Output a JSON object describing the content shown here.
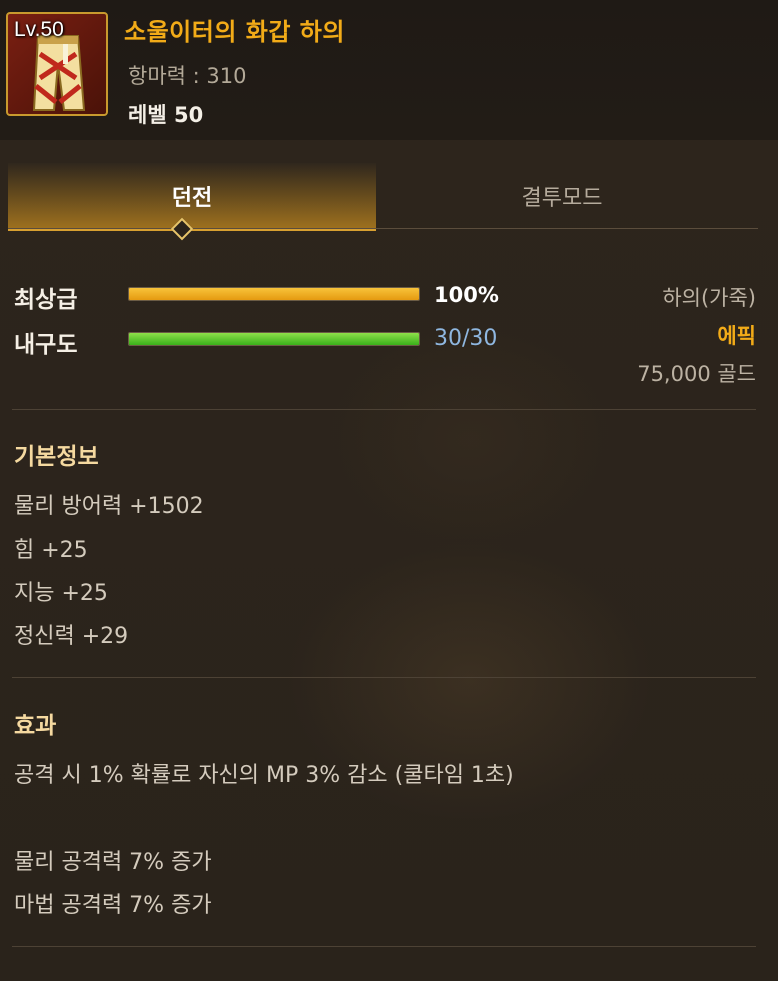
{
  "item": {
    "level_badge": "Lv.50",
    "name": "소울이터의 화갑 하의",
    "magic_resistance": "항마력 : 310",
    "required_level": "레벨 50",
    "icon": "leather-pants-icon"
  },
  "tabs": [
    {
      "label": "던전",
      "active": true
    },
    {
      "label": "결투모드",
      "active": false
    }
  ],
  "stats": {
    "quality_label": "최상급",
    "quality_value": "100%",
    "quality_fraction": 1.0,
    "durability_label": "내구도",
    "durability_value": "30/30",
    "durability_fraction": 1.0
  },
  "side": {
    "type": "하의(가죽)",
    "rarity": "에픽",
    "price": "75,000 골드"
  },
  "basic_info": {
    "title": "기본정보",
    "lines": [
      "물리 방어력 +1502",
      "힘 +25",
      "지능 +25",
      "정신력 +29"
    ]
  },
  "effects": {
    "title": "효과",
    "lines": [
      "공격 시 1% 확률로 자신의 MP 3% 감소 (쿨타임 1초)",
      "물리 공격력 7% 증가",
      "마법 공격력 7% 증가"
    ]
  },
  "colors": {
    "title_gold": "#f2ab18",
    "rarity_epic": "#f2ab18",
    "durability_blue": "#8fb7e0"
  }
}
